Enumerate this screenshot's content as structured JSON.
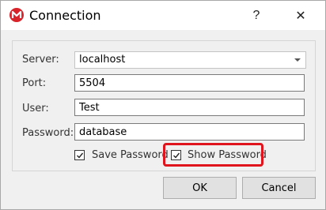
{
  "window": {
    "title": "Connection",
    "help_glyph": "?",
    "close_glyph": "✕",
    "app_icon": "app-logo-icon"
  },
  "form": {
    "server": {
      "label": "Server:",
      "value": "localhost"
    },
    "port": {
      "label": "Port:",
      "value": "5504"
    },
    "user": {
      "label": "User:",
      "value": "Test"
    },
    "password": {
      "label": "Password:",
      "value": "database"
    }
  },
  "options": {
    "save_password": {
      "label": "Save Password",
      "checked": true
    },
    "show_password": {
      "label": "Show Password",
      "checked": true
    }
  },
  "buttons": {
    "ok": "OK",
    "cancel": "Cancel"
  },
  "colors": {
    "highlight": "#e0141c",
    "app_icon": "#d9232a"
  }
}
